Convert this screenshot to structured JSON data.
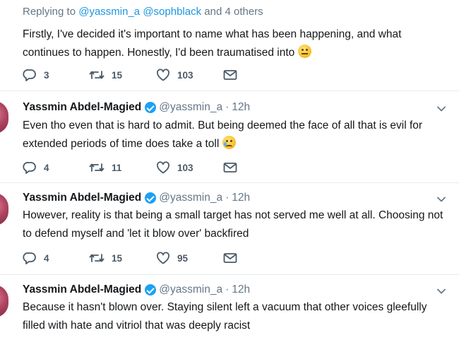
{
  "reply_tweet": {
    "replying_prefix": "Replying to",
    "mention_1": "@yassmin_a",
    "mention_2": "@sophblack",
    "others": "and 4 others",
    "text": "Firstly, I've decided it's important to name what has been happening, and what continues to happen. Honestly, I'd been traumatised into",
    "emoji": "neutral-face",
    "replies": "3",
    "retweets": "15",
    "likes": "103"
  },
  "tweets": [
    {
      "name": "Yassmin Abdel-Magied",
      "handle": "@yassmin_a",
      "dot": "·",
      "time": "12h",
      "text": "Even tho even that is hard to admit. But being deemed the face of all that is evil for extended periods of time does take a toll",
      "emoji": "sad-tear-face",
      "replies": "4",
      "retweets": "11",
      "likes": "103"
    },
    {
      "name": "Yassmin Abdel-Magied",
      "handle": "@yassmin_a",
      "dot": "·",
      "time": "12h",
      "text": "However, reality is that being a small target has not served me well at all. Choosing not to defend myself and 'let it blow over' backfired",
      "replies": "4",
      "retweets": "15",
      "likes": "95"
    },
    {
      "name": "Yassmin Abdel-Magied",
      "handle": "@yassmin_a",
      "dot": "·",
      "time": "12h",
      "text": "Because it hasn't blown over. Staying silent left a vacuum that other voices gleefully filled with hate and vitriol that was deeply racist"
    }
  ],
  "colors": {
    "link": "#1b95e0",
    "verified": "#1da1f2",
    "muted": "#657786",
    "text": "#14171a"
  },
  "icons": [
    "reply-icon",
    "retweet-icon",
    "like-icon",
    "direct-message-icon",
    "verified-badge-icon",
    "chevron-down-icon"
  ]
}
